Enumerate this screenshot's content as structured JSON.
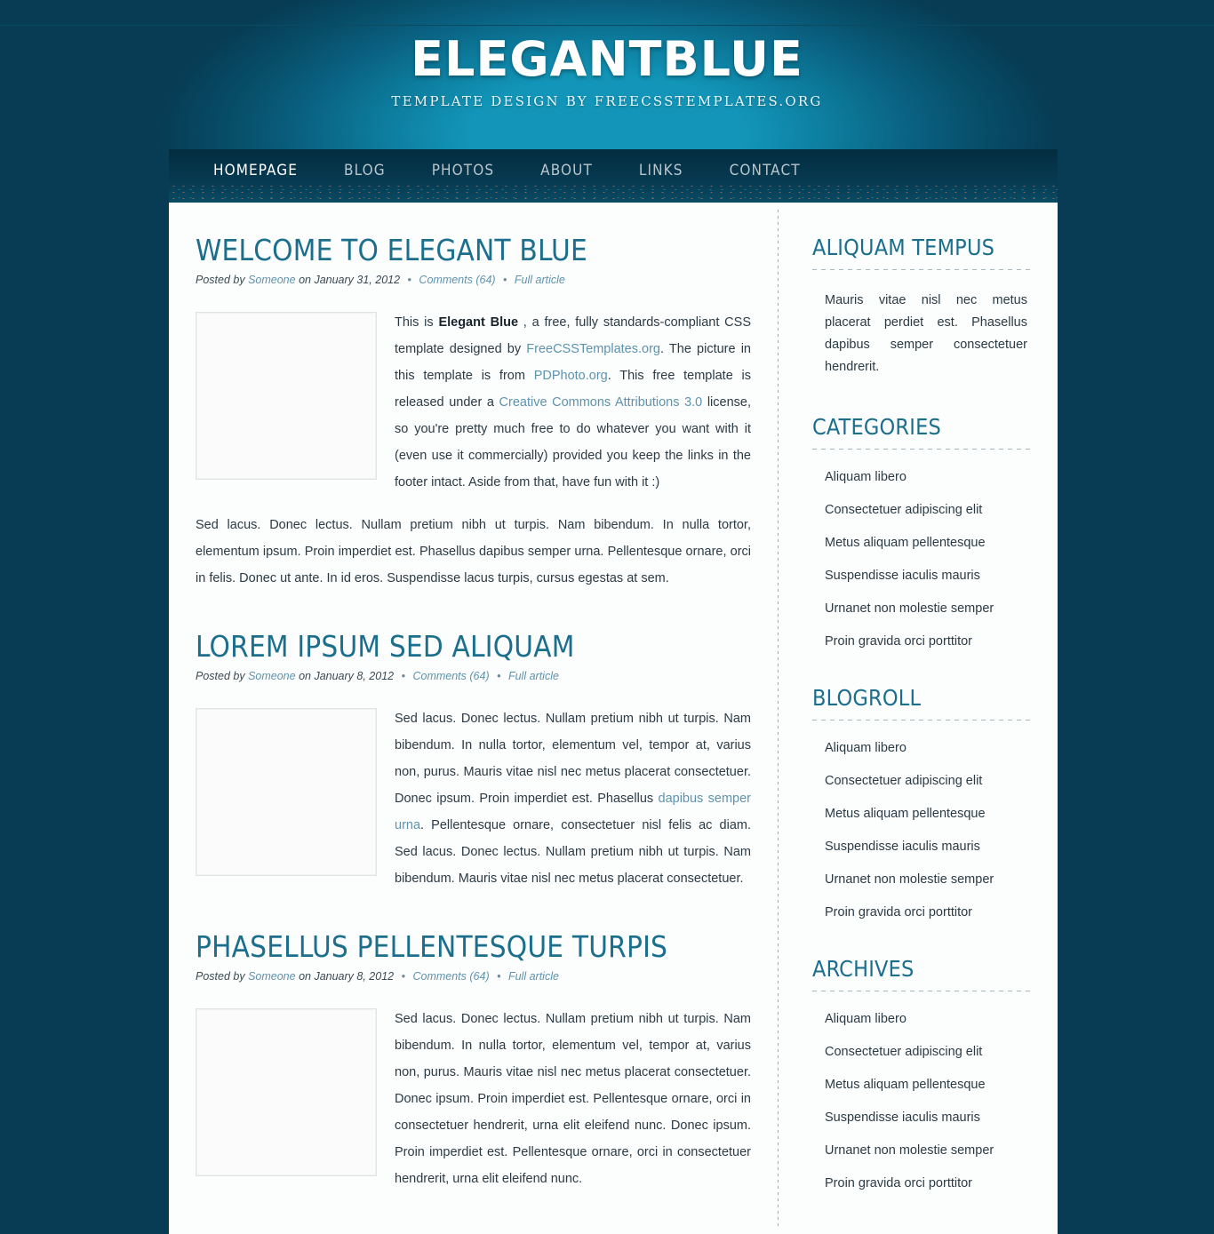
{
  "site": {
    "title": "ELEGANTBLUE",
    "tagline": "TEMPLATE DESIGN BY FREECSSTEMPLATES.ORG"
  },
  "nav": {
    "items": [
      {
        "label": "HOMEPAGE",
        "active": true
      },
      {
        "label": "BLOG",
        "active": false
      },
      {
        "label": "PHOTOS",
        "active": false
      },
      {
        "label": "ABOUT",
        "active": false
      },
      {
        "label": "LINKS",
        "active": false
      },
      {
        "label": "CONTACT",
        "active": false
      }
    ]
  },
  "posts": [
    {
      "title": "WELCOME TO ELEGANT BLUE",
      "meta": {
        "posted_by_prefix": "Posted by",
        "author": "Someone",
        "on_date": "on January 31, 2012",
        "comments": "Comments (64)",
        "full_article": "Full article",
        "separator": "•"
      },
      "image_name": "coin-penny-photo",
      "paragraph1_a": "This is ",
      "paragraph1_strong": "Elegant Blue",
      "paragraph1_b": " , a free, fully standards-compliant CSS template designed by ",
      "paragraph1_link1": "FreeCSSTemplates.org",
      "paragraph1_c": ". The picture in this template is from ",
      "paragraph1_link2": "PDPhoto.org",
      "paragraph1_d": ". This free template is released under a ",
      "paragraph1_link3": "Creative Commons Attributions 3.0",
      "paragraph1_e": " license, so you're pretty much free to do whatever you want with it (even use it commercially) provided you keep the links in the footer intact. Aside from that, have fun with it :)",
      "paragraph2": "Sed lacus. Donec lectus. Nullam pretium nibh ut turpis. Nam bibendum. In nulla tortor, elementum ipsum. Proin imperdiet est. Phasellus dapibus semper urna. Pellentesque ornare, orci in felis. Donec ut ante. In id eros. Suspendisse lacus turpis, cursus egestas at sem."
    },
    {
      "title": "LOREM IPSUM SED ALIQUAM",
      "meta": {
        "posted_by_prefix": "Posted by",
        "author": "Someone",
        "on_date": "on January 8, 2012",
        "comments": "Comments (64)",
        "full_article": "Full article",
        "separator": "•"
      },
      "image_name": "sailing-ship-photo",
      "paragraph1_a": "Sed lacus. Donec lectus. Nullam pretium nibh ut turpis. Nam bibendum. In nulla tortor, elementum vel, tempor at, varius non, purus. Mauris vitae nisl nec metus placerat consectetuer. Donec ipsum. Proin imperdiet est. Phasellus ",
      "paragraph1_link1": "dapibus semper urna",
      "paragraph1_b": ". Pellentesque ornare, consectetuer nisl felis ac diam. Sed lacus. Donec lectus. Nullam pretium nibh ut turpis. Nam bibendum. Mauris vitae nisl nec metus placerat consectetuer."
    },
    {
      "title": "PHASELLUS PELLENTESQUE TURPIS",
      "meta": {
        "posted_by_prefix": "Posted by",
        "author": "Someone",
        "on_date": "on January 8, 2012",
        "comments": "Comments (64)",
        "full_article": "Full article",
        "separator": "•"
      },
      "image_name": "coin-penny-photo-2",
      "paragraph1": "Sed lacus. Donec lectus. Nullam pretium nibh ut turpis. Nam bibendum. In nulla tortor, elementum vel, tempor at, varius non, purus. Mauris vitae nisl nec metus placerat consectetuer. Donec ipsum. Proin imperdiet est. Pellentesque ornare, orci in consectetuer hendrerit, urna elit eleifend nunc. Donec ipsum. Proin imperdiet est. Pellentesque ornare, orci in consectetuer hendrerit, urna elit eleifend nunc."
    }
  ],
  "sidebar": {
    "blocks": [
      {
        "title": "ALIQUAM TEMPUS",
        "type": "text",
        "text": "Mauris vitae nisl nec metus placerat perdiet est. Phasellus dapibus semper consectetuer hendrerit."
      },
      {
        "title": "CATEGORIES",
        "type": "list",
        "items": [
          "Aliquam libero",
          "Consectetuer adipiscing elit",
          "Metus aliquam pellentesque",
          "Suspendisse iaculis mauris",
          "Urnanet non molestie semper",
          "Proin gravida orci porttitor"
        ]
      },
      {
        "title": "BLOGROLL",
        "type": "list",
        "items": [
          "Aliquam libero",
          "Consectetuer adipiscing elit",
          "Metus aliquam pellentesque",
          "Suspendisse iaculis mauris",
          "Urnanet non molestie semper",
          "Proin gravida orci porttitor"
        ]
      },
      {
        "title": "ARCHIVES",
        "type": "list",
        "items": [
          "Aliquam libero",
          "Consectetuer adipiscing elit",
          "Metus aliquam pellentesque",
          "Suspendisse iaculis mauris",
          "Urnanet non molestie semper",
          "Proin gravida orci porttitor"
        ]
      }
    ]
  },
  "colors": {
    "background_dark": "#073c54",
    "background_glow": "#1295b8",
    "nav_bar": "#063950",
    "heading_teal": "#1b6e8c",
    "body_text": "#2b3b46",
    "link_blue": "#5e93ad",
    "content_bg": "#fcfdfd"
  }
}
